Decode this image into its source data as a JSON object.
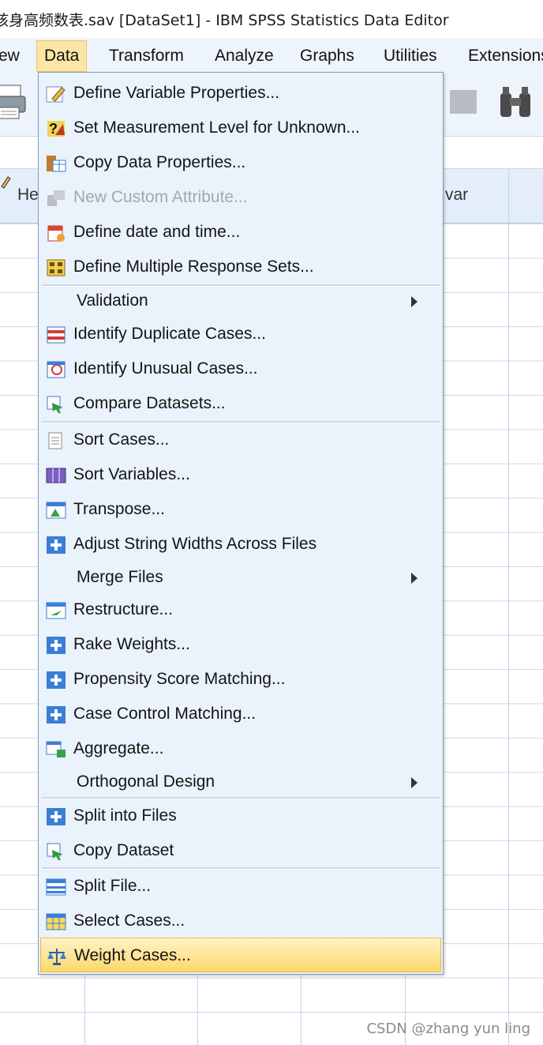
{
  "window": {
    "title": "孩身高频数表.sav [DataSet1] - IBM SPSS Statistics Data Editor"
  },
  "menubar": {
    "items": [
      "ew",
      "Data",
      "Transform",
      "Analyze",
      "Graphs",
      "Utilities",
      "Extensions"
    ]
  },
  "grid": {
    "header_partial": "He",
    "header_var": "var"
  },
  "dropdown": {
    "items": [
      {
        "label": "Define Variable Properties...",
        "icon": "define-variable-properties-icon"
      },
      {
        "label": "Set Measurement Level for Unknown...",
        "icon": "measurement-level-icon"
      },
      {
        "label": "Copy Data Properties...",
        "icon": "copy-data-properties-icon"
      },
      {
        "label": "New Custom Attribute...",
        "icon": "custom-attribute-icon",
        "disabled": true
      },
      {
        "label": "Define date and time...",
        "icon": "calendar-icon"
      },
      {
        "label": "Define Multiple Response Sets...",
        "icon": "multiple-response-icon"
      },
      {
        "label": "Validation",
        "submenu": true
      },
      {
        "label": "Identify Duplicate Cases...",
        "icon": "duplicate-cases-icon"
      },
      {
        "label": "Identify Unusual Cases...",
        "icon": "unusual-cases-icon"
      },
      {
        "label": "Compare Datasets...",
        "icon": "compare-datasets-icon"
      },
      {
        "label": "Sort Cases...",
        "icon": "sort-cases-icon"
      },
      {
        "label": "Sort Variables...",
        "icon": "sort-variables-icon"
      },
      {
        "label": "Transpose...",
        "icon": "transpose-icon"
      },
      {
        "label": "Adjust String Widths Across Files",
        "icon": "plus-icon"
      },
      {
        "label": "Merge Files",
        "submenu": true
      },
      {
        "label": "Restructure...",
        "icon": "restructure-icon"
      },
      {
        "label": "Rake Weights...",
        "icon": "plus-icon"
      },
      {
        "label": "Propensity Score Matching...",
        "icon": "plus-icon"
      },
      {
        "label": "Case Control Matching...",
        "icon": "plus-icon"
      },
      {
        "label": "Aggregate...",
        "icon": "aggregate-icon"
      },
      {
        "label": "Orthogonal Design",
        "submenu": true
      },
      {
        "label": "Split into Files",
        "icon": "plus-icon"
      },
      {
        "label": "Copy Dataset",
        "icon": "copy-dataset-icon"
      },
      {
        "label": "Split File...",
        "icon": "split-file-icon"
      },
      {
        "label": "Select Cases...",
        "icon": "select-cases-icon"
      },
      {
        "label": "Weight Cases...",
        "icon": "weight-cases-icon",
        "highlighted": true
      }
    ]
  },
  "watermark": "CSDN @zhang yun ling",
  "colors": {
    "menu_bg": "#eaf2fb",
    "highlight": "#fcd86a",
    "icon_blue": "#3a7fd5"
  }
}
